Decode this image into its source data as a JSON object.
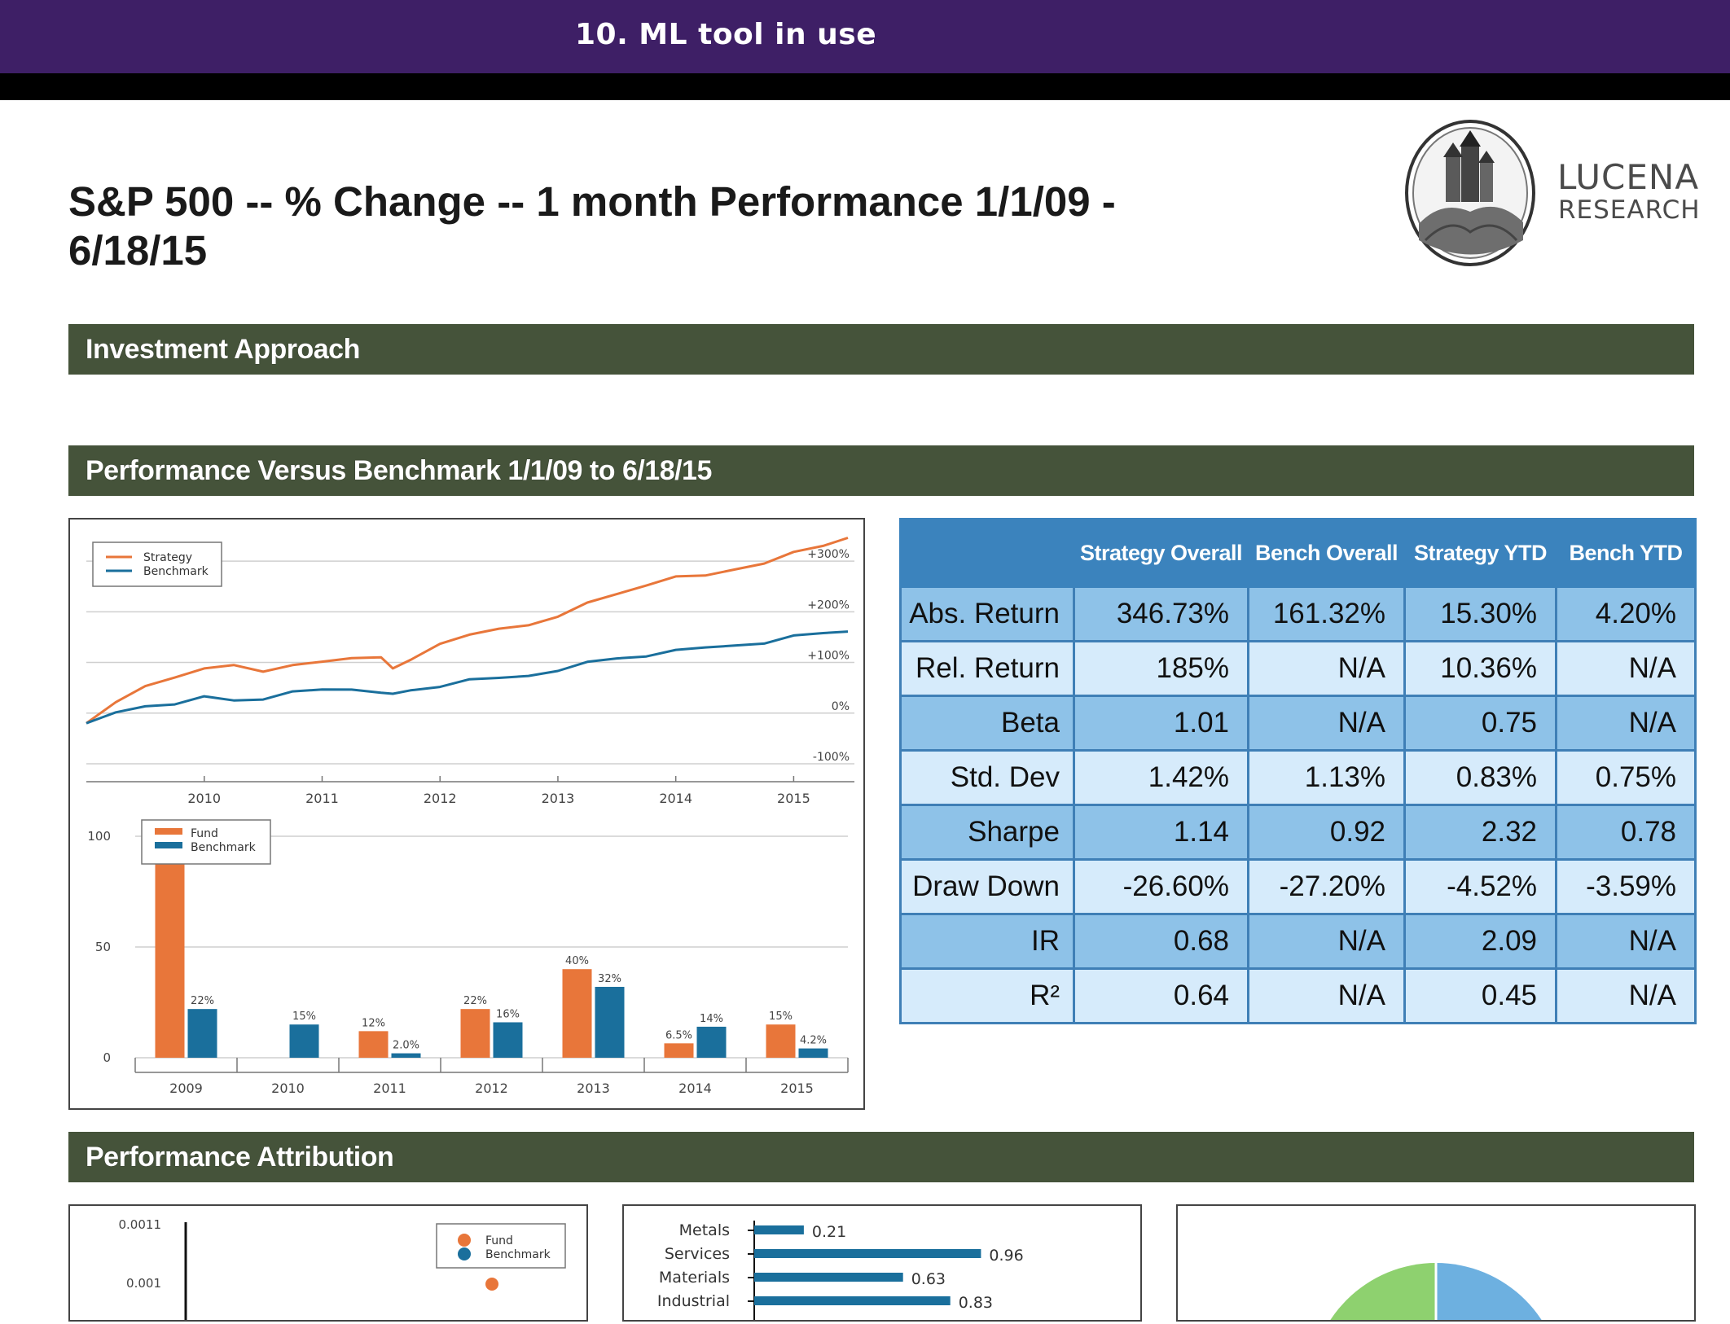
{
  "header": {
    "title": "10. ML tool in use"
  },
  "report": {
    "title": "S&P 500 -- % Change -- 1 month Performance 1/1/09 - 6/18/15",
    "logo_name": "LUCENA",
    "logo_sub": "RESEARCH"
  },
  "sections": {
    "investment_approach": "Investment Approach",
    "performance_vs_benchmark": "Performance Versus Benchmark 1/1/09 to 6/18/15",
    "performance_attribution": "Performance Attribution"
  },
  "colors": {
    "strategy": "#e8763a",
    "benchmark": "#1a6f9c",
    "section_bar": "#45533a",
    "header_bar": "#3e1f66",
    "table_header": "#3b83bd"
  },
  "metrics_table": {
    "columns": [
      "Strategy Overall",
      "Bench Overall",
      "Strategy YTD",
      "Bench YTD"
    ],
    "rows": [
      {
        "label": "Abs. Return",
        "values": [
          "346.73%",
          "161.32%",
          "15.30%",
          "4.20%"
        ]
      },
      {
        "label": "Rel. Return",
        "values": [
          "185%",
          "N/A",
          "10.36%",
          "N/A"
        ]
      },
      {
        "label": "Beta",
        "values": [
          "1.01",
          "N/A",
          "0.75",
          "N/A"
        ]
      },
      {
        "label": "Std. Dev",
        "values": [
          "1.42%",
          "1.13%",
          "0.83%",
          "0.75%"
        ]
      },
      {
        "label": "Sharpe",
        "values": [
          "1.14",
          "0.92",
          "2.32",
          "0.78"
        ]
      },
      {
        "label": "Draw Down",
        "values": [
          "-26.60%",
          "-27.20%",
          "-4.52%",
          "-3.59%"
        ]
      },
      {
        "label": "IR",
        "values": [
          "0.68",
          "N/A",
          "2.09",
          "N/A"
        ]
      },
      {
        "label": "R²",
        "values": [
          "0.64",
          "N/A",
          "0.45",
          "N/A"
        ]
      }
    ]
  },
  "chart_data": [
    {
      "type": "line",
      "legend": [
        "Strategy",
        "Benchmark"
      ],
      "x_ticks": [
        "2010",
        "2011",
        "2012",
        "2013",
        "2014",
        "2015"
      ],
      "y_ticks": [
        "+300%",
        "+200%",
        "+100%",
        "0%",
        "-100%"
      ],
      "ylim": [
        -100,
        350
      ],
      "legend_position": "top-left",
      "series": [
        {
          "name": "Strategy",
          "x": [
            2009.0,
            2009.25,
            2009.5,
            2009.75,
            2010.0,
            2010.25,
            2010.5,
            2010.75,
            2011.0,
            2011.25,
            2011.5,
            2011.6,
            2011.75,
            2012.0,
            2012.25,
            2012.5,
            2012.75,
            2013.0,
            2013.25,
            2013.5,
            2013.75,
            2014.0,
            2014.25,
            2014.5,
            2014.75,
            2015.0,
            2015.25,
            2015.46
          ],
          "values": [
            -20,
            20,
            55,
            75,
            85,
            95,
            85,
            90,
            100,
            110,
            115,
            85,
            105,
            140,
            150,
            165,
            175,
            195,
            215,
            235,
            255,
            265,
            270,
            285,
            300,
            315,
            330,
            346
          ]
        },
        {
          "name": "Benchmark",
          "x": [
            2009.0,
            2009.25,
            2009.5,
            2009.75,
            2010.0,
            2010.25,
            2010.5,
            2010.75,
            2011.0,
            2011.25,
            2011.5,
            2011.6,
            2011.75,
            2012.0,
            2012.25,
            2012.5,
            2012.75,
            2013.0,
            2013.25,
            2013.5,
            2013.75,
            2014.0,
            2014.25,
            2014.5,
            2014.75,
            2015.0,
            2015.25,
            2015.46
          ],
          "values": [
            -20,
            0,
            15,
            22,
            30,
            25,
            30,
            38,
            45,
            48,
            45,
            35,
            45,
            55,
            62,
            68,
            75,
            88,
            98,
            108,
            115,
            120,
            128,
            135,
            142,
            150,
            158,
            161
          ]
        }
      ]
    },
    {
      "type": "bar",
      "legend": [
        "Fund",
        "Benchmark"
      ],
      "categories": [
        "2009",
        "2010",
        "2011",
        "2012",
        "2013",
        "2014",
        "2015"
      ],
      "ylim": [
        0,
        100
      ],
      "y_ticks": [
        "100",
        "50",
        "0"
      ],
      "legend_position": "top-left",
      "series": [
        {
          "name": "Fund",
          "values": [
            90,
            0,
            12,
            22,
            40,
            6.5,
            15
          ],
          "labels": [
            "",
            "",
            "12%",
            "22%",
            "40%",
            "6.5%",
            "15%"
          ]
        },
        {
          "name": "Benchmark",
          "values": [
            22,
            15,
            2.0,
            16,
            32,
            14,
            4.2
          ],
          "labels": [
            "22%",
            "15%",
            "2.0%",
            "16%",
            "32%",
            "14%",
            "4.2%"
          ]
        }
      ]
    },
    {
      "type": "scatter",
      "legend": [
        "Fund",
        "Benchmark"
      ],
      "y_ticks": [
        "0.0011",
        "0.001"
      ],
      "legend_position": "top-right"
    },
    {
      "type": "bar",
      "orientation": "horizontal",
      "categories": [
        "Metals",
        "Services",
        "Materials",
        "Industrial"
      ],
      "values": [
        0.21,
        0.96,
        0.63,
        0.83
      ],
      "labels": [
        "0.21",
        "0.96",
        "0.63",
        "0.83"
      ]
    },
    {
      "type": "pie",
      "colors": [
        "#8ed16f",
        "#6db0e0"
      ]
    }
  ]
}
